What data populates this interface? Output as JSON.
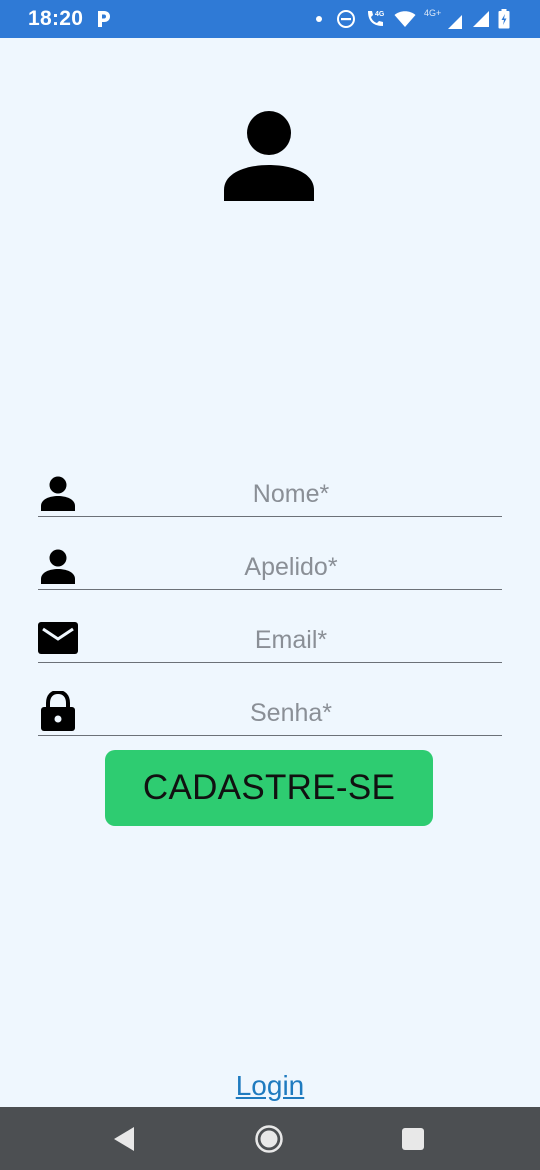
{
  "status_bar": {
    "time": "18:20",
    "icons": [
      "parking-icon",
      "notification-dot",
      "do-not-disturb-icon",
      "volte-call-icon",
      "wifi-icon",
      "signal-4g-icon",
      "signal-icon",
      "battery-icon"
    ]
  },
  "avatar": {
    "icon": "user-avatar-icon"
  },
  "form": {
    "name_placeholder": "Nome*",
    "surname_placeholder": "Apelido*",
    "email_placeholder": "Email*",
    "password_placeholder": "Senha*"
  },
  "submit_label": "CADASTRE-SE",
  "login_link": "Login",
  "colors": {
    "status_bar": "#2f7ad6",
    "background": "#eff7fe",
    "button": "#2ecc71",
    "link": "#1f7bbf",
    "nav_bar": "#4c4f52"
  },
  "nav": {
    "back": "back-icon",
    "home": "home-icon",
    "recents": "recents-icon"
  }
}
